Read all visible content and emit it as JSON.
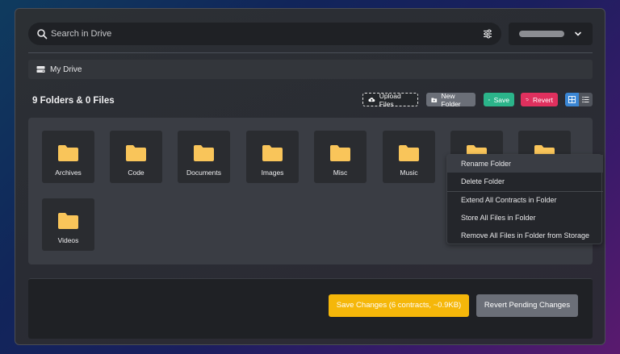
{
  "search": {
    "placeholder": "Search in Drive"
  },
  "breadcrumb": {
    "label": "My Drive"
  },
  "summary": {
    "heading": "9 Folders & 0 Files"
  },
  "toolbar": {
    "upload_label": "Upload Files",
    "new_folder_label": "New Folder",
    "save_label": "Save",
    "revert_label": "Revert"
  },
  "folders": [
    "Archives",
    "Code",
    "Documents",
    "Images",
    "Misc",
    "Music",
    "",
    "",
    "Videos"
  ],
  "context_menu": {
    "items": [
      "Rename Folder",
      "Delete Folder",
      "Extend All Contracts in Folder",
      "Store All Files in Folder",
      "Remove All Files in Folder from Storage"
    ]
  },
  "footer": {
    "save_changes_label": "Save Changes (6 contracts, ~0.9KB)",
    "revert_changes_label": "Revert Pending Changes"
  },
  "colors": {
    "folder": "#f9c55a",
    "save_accent": "#2bb48a",
    "revert_accent": "#e0305e",
    "primary_accent": "#3a86d4",
    "warning_accent": "#f5b70a"
  }
}
